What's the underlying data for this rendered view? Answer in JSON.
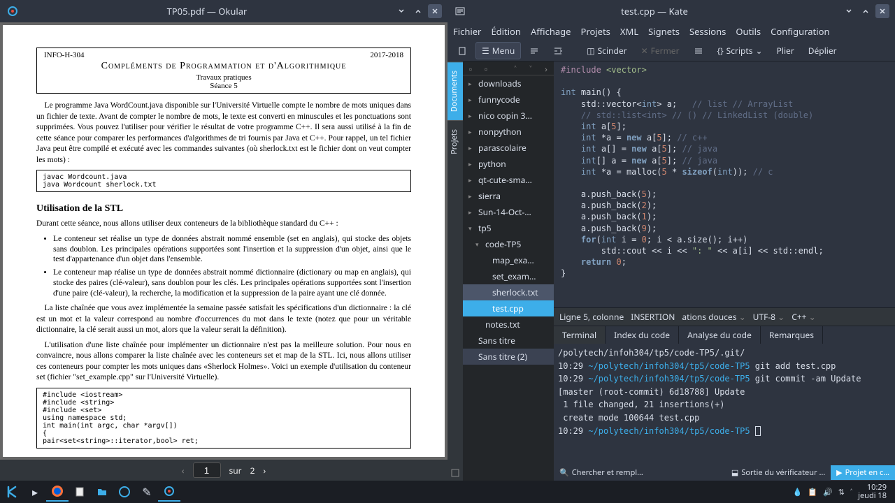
{
  "okular": {
    "title": "TP05.pdf — Okular",
    "page_current": "1",
    "page_sep": "sur",
    "page_total": "2",
    "doc": {
      "hdr_left": "INFO-H-304",
      "hdr_right": "2017-2018",
      "main_title": "Compléments de Programmation et d'Algorithmique",
      "subtitle1": "Travaux pratiques",
      "subtitle2": "Séance 5",
      "intro_para": "Le programme Java WordCount.java disponible sur l'Université Virtuelle compte le nombre de mots uniques dans un fichier de texte. Avant de compter le nombre de mots, le texte est converti en minuscules et les ponctuations sont supprimées. Vous pouvez l'utiliser pour vérifier le résultat de votre programme C++. Il sera aussi utilisé à la fin de cette séance pour comparer les performances d'algorithmes de tri fournis par Java et C++. Pour rappel, un tel fichier Java peut être compilé et exécuté avec les commandes suivantes (où sherlock.txt est le fichier dont on veut compter les mots) :",
      "code_block1_l1": "javac Wordcount.java",
      "code_block1_l2": "java Wordcount sherlock.txt",
      "h2": "Utilisation de la STL",
      "para2": "Durant cette séance, nous allons utiliser deux conteneurs de la bibliothèque standard du C++ :",
      "li1": "Le conteneur set réalise un type de données abstrait nommé ensemble (set en anglais), qui stocke des objets sans doublon. Les principales opérations supportées sont l'insertion et la suppression d'un objet, ainsi que le test d'appartenance d'un objet dans l'ensemble.",
      "li2": "Le conteneur map réalise un type de données abstrait nommé dictionnaire (dictionary ou map en anglais), qui stocke des paires (clé-valeur), sans doublon pour les clés. Les principales opérations supportées sont l'insertion d'une paire (clé-valeur), la recherche, la modification et la suppression de la paire ayant une clé donnée.",
      "para3": "La liste chaînée que vous avez implémentée la semaine passée satisfait les spécifications d'un dictionnaire : la clé est un mot et la valeur correspond au nombre d'occurrences du mot dans le texte (notez que pour un véritable dictionnaire, la clé serait aussi un mot, alors que la valeur serait la définition).",
      "para4": "L'utilisation d'une liste chaînée pour implémenter un dictionnaire n'est pas la meilleure solution. Pour nous en convaincre, nous allons comparer la liste chaînée avec les conteneurs set et map de la STL. Ici, nous allons utiliser ces conteneurs pour compter les mots uniques dans «Sherlock Holmes». Voici un exemple d'utilisation du conteneur set (fichier \"set_example.cpp\" sur l'Université Virtuelle).",
      "code2_lines": [
        "#include <iostream>",
        "#include <string>",
        "#include <set>",
        "using namespace std;",
        "",
        "int main(int argc, char *argv[])",
        "{",
        "    pair<set<string>::iterator,bool> ret;"
      ]
    }
  },
  "kate": {
    "title": "test.cpp — Kate",
    "menu": [
      "Fichier",
      "Édition",
      "Affichage",
      "Projets",
      "XML",
      "Signets",
      "Sessions",
      "Outils",
      "Configuration"
    ],
    "toolbar": {
      "menu_btn": "Menu",
      "split": "Scinder",
      "close": "Fermer",
      "scripts": "Scripts",
      "fold": "Plier",
      "unfold": "Déplier"
    },
    "sidetabs": [
      "Documents",
      "Projets"
    ],
    "tree": [
      {
        "label": "downloads",
        "depth": 0,
        "expand": true
      },
      {
        "label": "funnycode",
        "depth": 0,
        "expand": true
      },
      {
        "label": "nico copin 3…",
        "depth": 0,
        "expand": true
      },
      {
        "label": "nonpython",
        "depth": 0,
        "expand": true
      },
      {
        "label": "parascolaire",
        "depth": 0,
        "expand": true
      },
      {
        "label": "python",
        "depth": 0,
        "expand": true
      },
      {
        "label": "qt-cute-sma…",
        "depth": 0,
        "expand": true
      },
      {
        "label": "sierra",
        "depth": 0,
        "expand": true
      },
      {
        "label": "Sun-14-Oct-…",
        "depth": 0,
        "expand": true
      },
      {
        "label": "tp5",
        "depth": 0,
        "expand": true,
        "open": true
      },
      {
        "label": "code-TP5",
        "depth": 1,
        "expand": true,
        "open": true
      },
      {
        "label": "map_exa…",
        "depth": 2
      },
      {
        "label": "set_exam…",
        "depth": 2
      },
      {
        "label": "sherlock.txt",
        "depth": 2,
        "selinactive": true
      },
      {
        "label": "test.cpp",
        "depth": 2,
        "selected": true
      },
      {
        "label": "notes.txt",
        "depth": 1
      },
      {
        "label": "Sans titre",
        "depth": 0
      },
      {
        "label": "Sans titre (2)",
        "depth": 0,
        "selhover": true
      }
    ],
    "status": {
      "pos": "Ligne 5, colonne",
      "mode": "INSERTION",
      "indent": "ations douces",
      "enc": "UTF-8",
      "lang": "C++"
    },
    "tabs": [
      "Terminal",
      "Index du code",
      "Analyse du code",
      "Remarques"
    ],
    "terminal": {
      "l1": "/polytech/infoh304/tp5/code-TP5/.git/",
      "t2_time": "10:29",
      "t2_path": "~/polytech/infoh304/tp5/code-TP5",
      "t2_cmd": "git add test.cpp",
      "t3_time": "10:29",
      "t3_path": "~/polytech/infoh304/tp5/code-TP5",
      "t3_cmd": "git commit -am Update",
      "t4": "[master (root-commit) 6d18788] Update",
      "t5": " 1 file changed, 21 insertions(+)",
      "t6": " create mode 100644 test.cpp",
      "t7_time": "10:29",
      "t7_path": "~/polytech/infoh304/tp5/code-TP5"
    },
    "bottom_btns": {
      "search": "Chercher et rempl…",
      "verifier": "Sortie du vérificateur …",
      "project": "Projet en c…"
    }
  },
  "taskbar": {
    "time": "10:29",
    "date": "jeudi 18"
  }
}
